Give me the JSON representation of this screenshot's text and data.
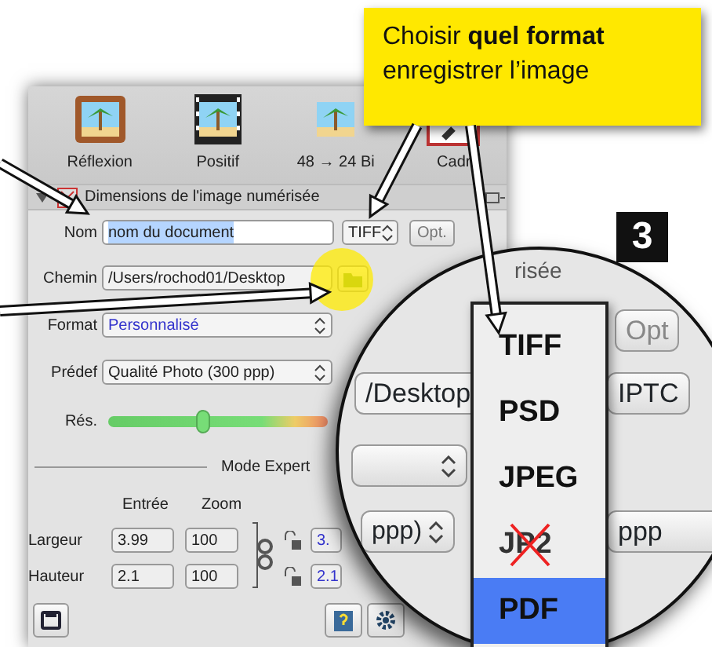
{
  "callout": {
    "line_1": "Choisir **quel format**",
    "line_2": "enregistrer l’image"
  },
  "step_badge": "3",
  "toolbar": [
    {
      "label": "Réflexion",
      "kind": "reflection"
    },
    {
      "label": "Positif",
      "kind": "film"
    },
    {
      "label": "48 → 24 Bi",
      "kind": "plain"
    },
    {
      "label": "Cadr",
      "kind": "tool"
    }
  ],
  "section": {
    "title": "Dimensions de l'image numérisée",
    "expanded": true
  },
  "form": {
    "name_label": "Nom",
    "name_value": "nom du document",
    "format_button": "TIFF",
    "options_button": "Opt.",
    "path_label": "Chemin",
    "path_value": "/Users/rochod01/Desktop",
    "format_label": "Format",
    "format_value": "Personnalisé",
    "preset_label": "Prédef",
    "preset_value": "Qualité Photo (300 ppp)",
    "resolution_label": "Rés.",
    "resolution": {
      "level": 0.43
    },
    "mode_label": "Mode Expert",
    "columns": [
      "Entrée",
      "Zoom"
    ],
    "rows": [
      {
        "label": "Largeur",
        "input": "3.99",
        "zoom": "100",
        "output": "3."
      },
      {
        "label": "Hauteur",
        "input": "2.1",
        "zoom": "100",
        "output": "2.1"
      }
    ]
  },
  "magnifier": {
    "heading": "risée",
    "options_button": "Opt",
    "path_value": "/Desktop",
    "iptc_button": "IPTC",
    "preset_value": "ppp)",
    "output_text": "ppp"
  },
  "format_menu": [
    {
      "label": "TIFF",
      "selected": false,
      "disabled": false
    },
    {
      "label": "PSD",
      "selected": false,
      "disabled": false
    },
    {
      "label": "JPEG",
      "selected": false,
      "disabled": false
    },
    {
      "label": "JP2",
      "selected": false,
      "disabled": true
    },
    {
      "label": "PDF",
      "selected": true,
      "disabled": false
    }
  ]
}
